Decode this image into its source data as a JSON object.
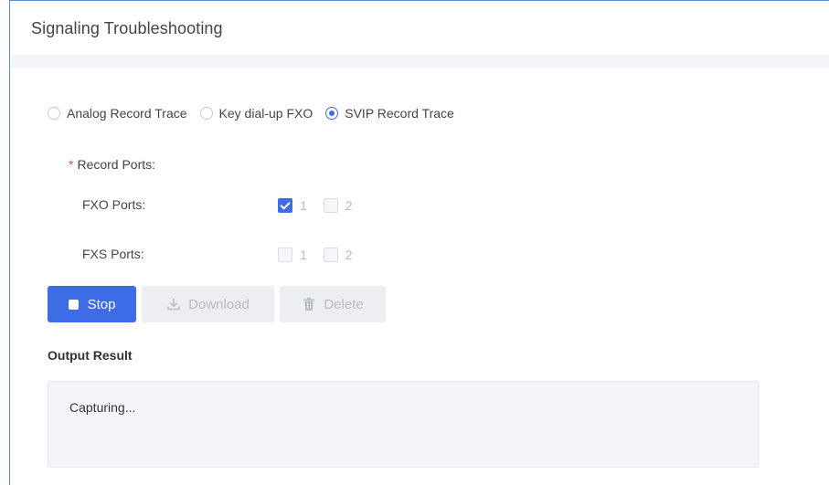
{
  "header": {
    "title": "Signaling Troubleshooting"
  },
  "trace_types": [
    {
      "label": "Analog Record Trace",
      "selected": false
    },
    {
      "label": "Key dial-up FXO",
      "selected": false
    },
    {
      "label": "SVIP Record Trace",
      "selected": true
    }
  ],
  "record_ports": {
    "required_mark": "*",
    "label": "Record Ports:",
    "fxo": {
      "label": "FXO Ports:",
      "ports": [
        {
          "num": "1",
          "checked": true
        },
        {
          "num": "2",
          "checked": false
        }
      ]
    },
    "fxs": {
      "label": "FXS Ports:",
      "ports": [
        {
          "num": "1",
          "checked": false
        },
        {
          "num": "2",
          "checked": false
        }
      ]
    }
  },
  "actions": {
    "stop": "Stop",
    "download": "Download",
    "delete": "Delete"
  },
  "output": {
    "title": "Output Result",
    "text": "Capturing..."
  },
  "colors": {
    "accent": "#3d6ce6",
    "frame_border": "#5b8fd4",
    "required": "#f04545"
  },
  "icons": {
    "stop": "stop-square-icon",
    "download": "download-icon",
    "delete": "trash-icon"
  }
}
